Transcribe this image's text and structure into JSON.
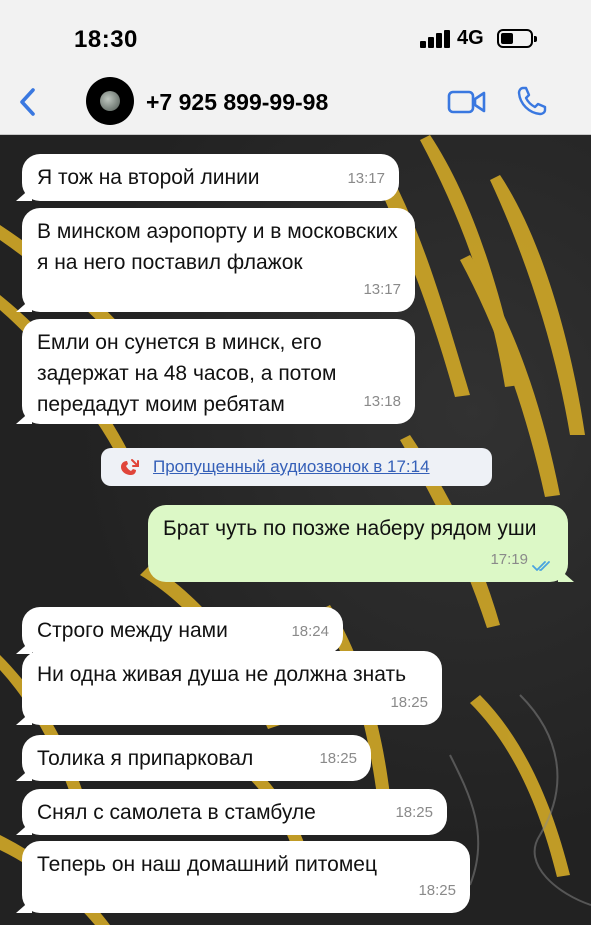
{
  "status": {
    "time": "18:30",
    "network": "4G"
  },
  "header": {
    "contact": "+7 925 899-99-98"
  },
  "colors": {
    "header_bg": "#f2f2f2",
    "incoming": "#ffffff",
    "outgoing": "#dcf8c6",
    "accent": "#3a78e0",
    "missed_red": "#e0453a"
  },
  "icons": [
    "back-chevron-icon",
    "video-call-icon",
    "phone-call-icon",
    "missed-call-icon",
    "read-ticks-icon"
  ],
  "messages": [
    {
      "dir": "in",
      "text": "Я тож на второй линии",
      "time": "13:17"
    },
    {
      "dir": "in",
      "text": "В минском аэропорту и в московских я на него поставил флажок",
      "time": "13:17"
    },
    {
      "dir": "in",
      "text": "Емли он сунется в минск, его задержат на 48 часов, а потом передадут моим ребятам",
      "time": "13:18"
    },
    {
      "dir": "system",
      "text": "Пропущенный аудиозвонок в 17:14"
    },
    {
      "dir": "out",
      "text": "Брат чуть по позже наберу рядом уши",
      "time": "17:19"
    },
    {
      "dir": "in",
      "text": "Строго между нами",
      "time": "18:24"
    },
    {
      "dir": "in",
      "text": "Ни одна живая душа не должна знать",
      "time": "18:25"
    },
    {
      "dir": "in",
      "text": "Толика я припарковал",
      "time": "18:25"
    },
    {
      "dir": "in",
      "text": "Снял с самолета в стамбуле",
      "time": "18:25"
    },
    {
      "dir": "in",
      "text": "Теперь он наш домашний питомец",
      "time": "18:25"
    }
  ]
}
